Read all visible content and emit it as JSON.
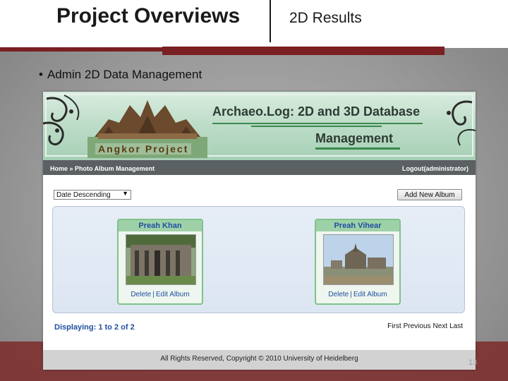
{
  "slide": {
    "title": "Project Overviews",
    "subtitle": "2D Results",
    "bullet": "Admin 2D Data Management",
    "page_number": "13"
  },
  "app": {
    "title": "Archaeo.Log: 2D and 3D Database",
    "title_line2": "Management",
    "project_label": "Angkor Project",
    "nav": {
      "breadcrumb": "Home » Photo Album Management",
      "logout": "Logout(administrator)"
    },
    "sort": {
      "selected": "Date Descending"
    },
    "add_album_label": "Add New Album",
    "albums": [
      {
        "title": "Preah Khan",
        "delete": "Delete",
        "separator": "|",
        "edit": "Edit Album"
      },
      {
        "title": "Preah Vihear",
        "delete": "Delete",
        "separator": "|",
        "edit": "Edit Album"
      }
    ],
    "displaying": "Displaying: 1 to 2 of 2",
    "pager": {
      "first": "First",
      "previous": "Previous",
      "next": "Next",
      "last": "Last"
    },
    "footer": "All Rights Reserved, Copyright © 2010 University of Heidelberg"
  },
  "colors": {
    "accent_red": "#7a1f22",
    "banner_green": "#a7d0b6",
    "link_blue": "#1f4fa0",
    "nav_gray": "#5b6063"
  }
}
